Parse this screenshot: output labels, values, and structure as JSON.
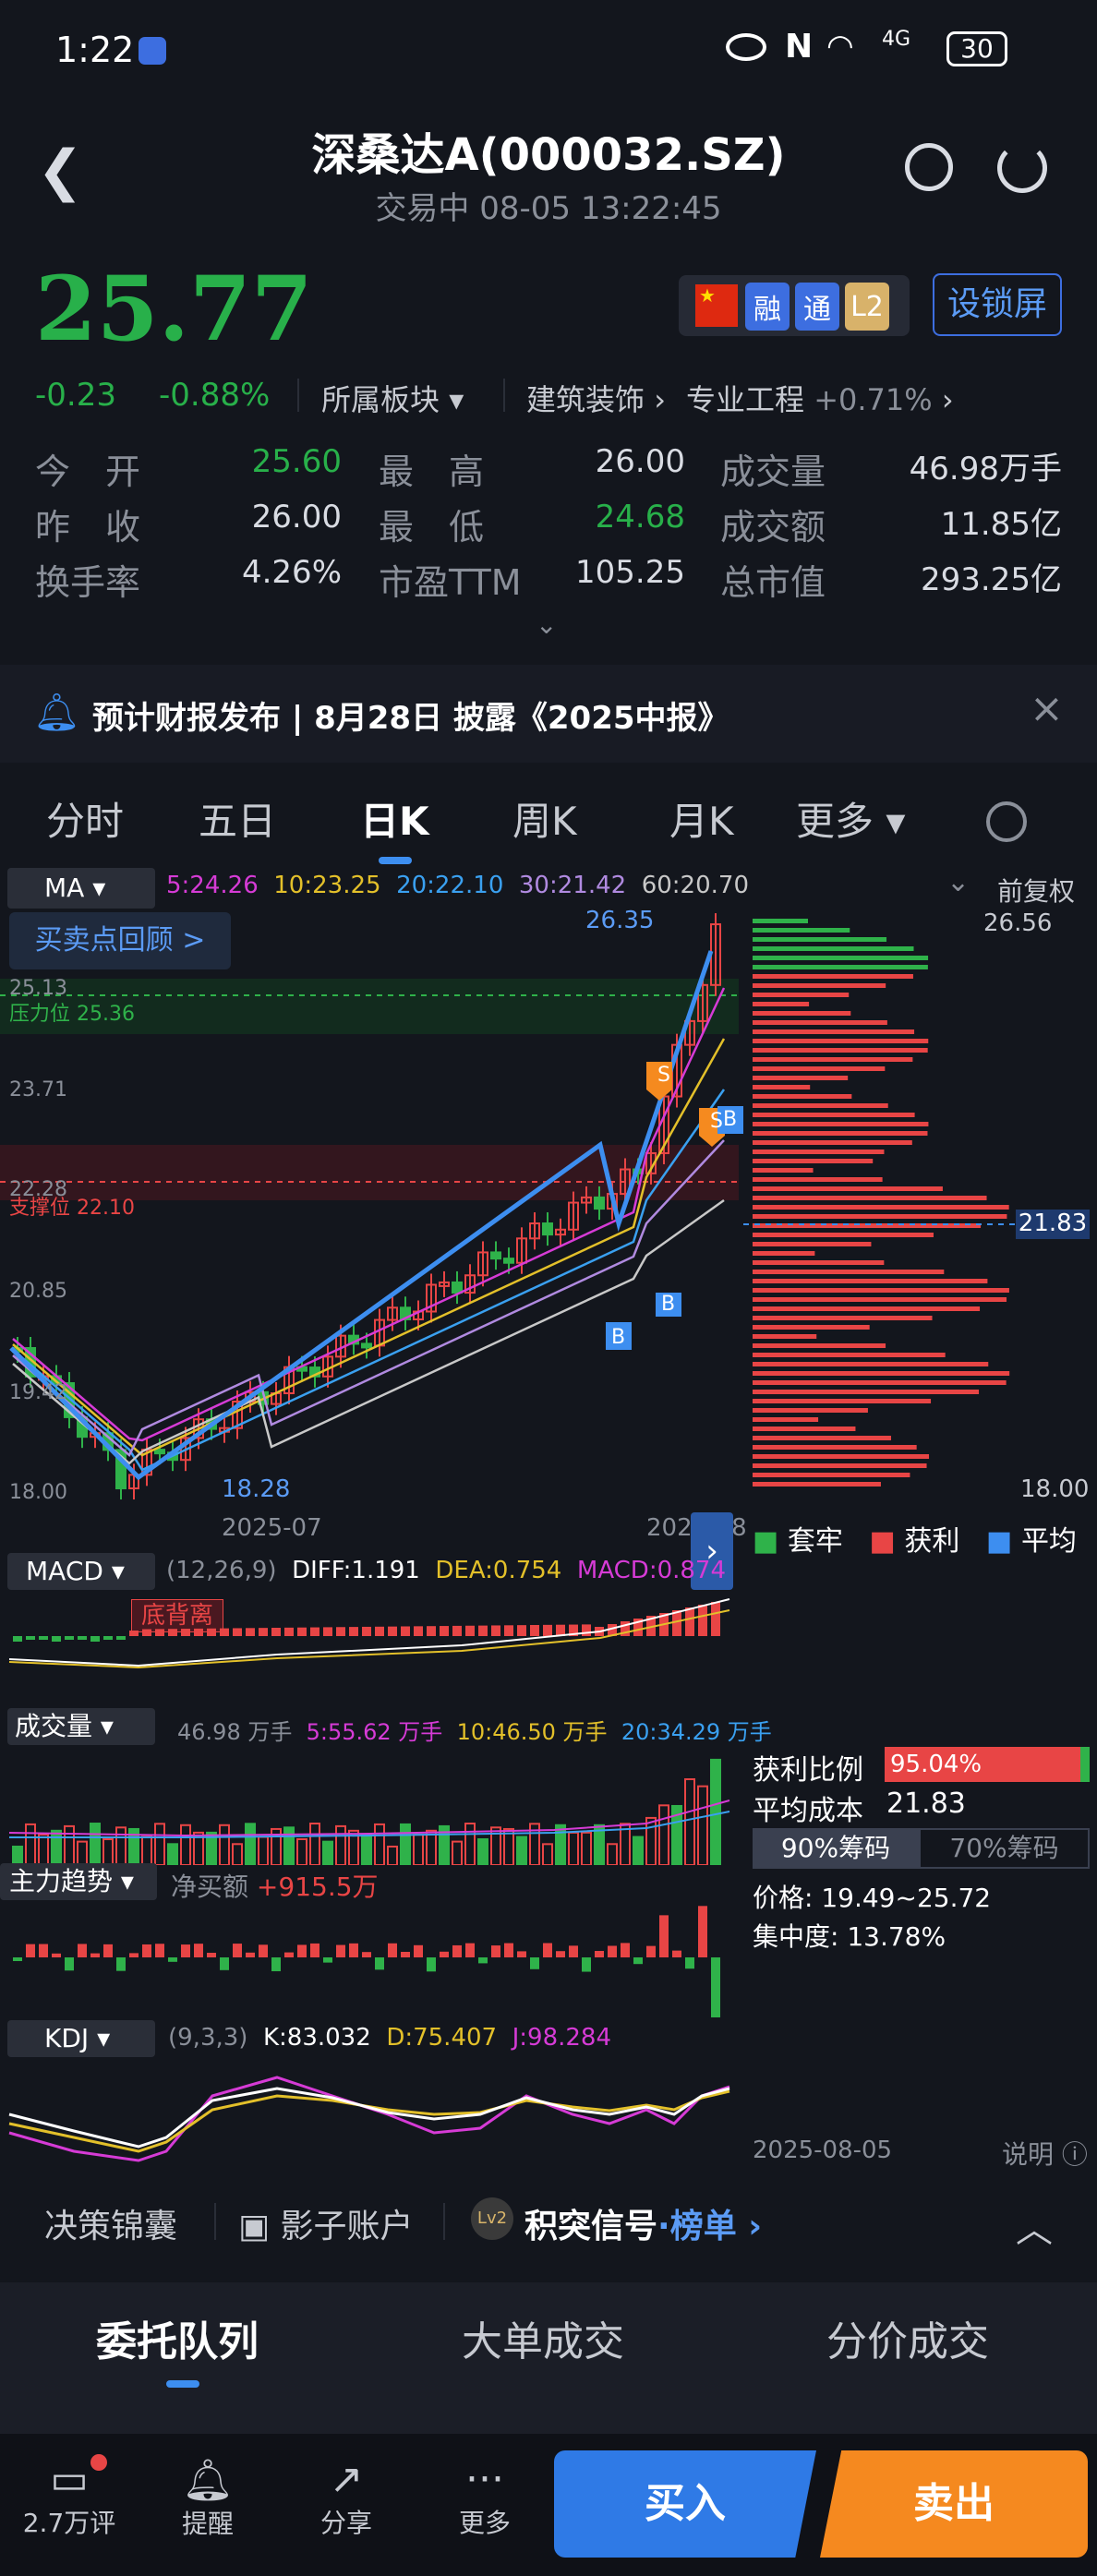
{
  "status": {
    "time": "1:22",
    "battery": "30",
    "network": "4G"
  },
  "header": {
    "title": "深桑达A(000032.SZ)",
    "subtitle": "交易中 08-05 13:22:45"
  },
  "quote": {
    "price": "25.77",
    "change": "-0.23",
    "change_pct": "-0.88%",
    "sector_label": "所属板块",
    "sector1": "建筑装饰",
    "sector2": "专业工程",
    "sector2_pct": "+0.71%",
    "tags": [
      "融",
      "通",
      "L2"
    ],
    "lock_btn": "设锁屏",
    "rows": [
      {
        "l1": "今　开",
        "v1": "25.60",
        "l2": "最　高",
        "v2": "26.00",
        "l3": "成交量",
        "v3": "46.98万手"
      },
      {
        "l1": "昨　收",
        "v1": "26.00",
        "l2": "最　低",
        "v2": "24.68",
        "l3": "成交额",
        "v3": "11.85亿"
      },
      {
        "l1": "换手率",
        "v1": "4.26%",
        "l2": "市盈TTM",
        "v2": "105.25",
        "l3": "总市值",
        "v3": "293.25亿"
      }
    ]
  },
  "notice": {
    "text": "预计财报发布 | 8月28日 披露《2025中报》"
  },
  "tabs": [
    "分时",
    "五日",
    "日K",
    "周K",
    "月K",
    "更多"
  ],
  "chart": {
    "ma_label": "MA",
    "ma": [
      "5:24.26",
      "10:23.25",
      "20:22.10",
      "30:21.42",
      "60:20.70"
    ],
    "ma_colors": [
      "#d63bd6",
      "#e3c02a",
      "#3aa0f0",
      "#b08ae0",
      "#c8c8c8"
    ],
    "review": "买卖点回顾 >",
    "fq": "前复权",
    "resist": "压力位 25.36",
    "support": "支撑位 22.10",
    "yticks": [
      "25.13",
      "23.71",
      "22.28",
      "20.85",
      "19.42",
      "18.00"
    ],
    "high": "26.35",
    "low": "18.28",
    "xticks": [
      "2025-07",
      "2025-08"
    ],
    "vp_top": "26.56",
    "vp_mid": "21.83",
    "vp_bot": "18.00",
    "legend": [
      "套牢",
      "获利",
      "平均"
    ]
  },
  "chart_data": {
    "type": "candlestick",
    "highlight": {
      "max": 26.35,
      "min": 18.28
    },
    "last_close": 25.77,
    "avg_cost": 21.83
  },
  "macd": {
    "label": "MACD",
    "params": "(12,26,9)",
    "diff": "DIFF:1.191",
    "dea": "DEA:0.754",
    "macd": "MACD:0.874",
    "tag": "底背离"
  },
  "vol": {
    "label": "成交量",
    "vals": [
      "46.98 万手",
      "5:55.62 万手",
      "10:46.50 万手",
      "20:34.29 万手"
    ]
  },
  "flow": {
    "label": "主力趋势",
    "text": "净买额",
    "val": "+915.5万"
  },
  "kdj": {
    "label": "KDJ",
    "params": "(9,3,3)",
    "k": "K:83.032",
    "d": "D:75.407",
    "j": "J:98.284"
  },
  "chips": {
    "profit_label": "获利比例",
    "profit": "95.04%",
    "avg_label": "平均成本",
    "avg": "21.83",
    "tab1": "90%筹码",
    "tab2": "70%筹码",
    "price": "价格: 19.49~25.72",
    "conc": "集中度: 13.78%",
    "date": "2025-08-05",
    "explain": "说明"
  },
  "tools": {
    "a": "决策锦囊",
    "b": "影子账户",
    "c": "积突信号",
    "d": "榜单"
  },
  "lower_tabs": [
    "委托队列",
    "大单成交",
    "分价成交"
  ],
  "bottom": {
    "comments": "2.7万评",
    "remind": "提醒",
    "share": "分享",
    "more": "更多",
    "buy": "买入",
    "sell": "卖出"
  }
}
